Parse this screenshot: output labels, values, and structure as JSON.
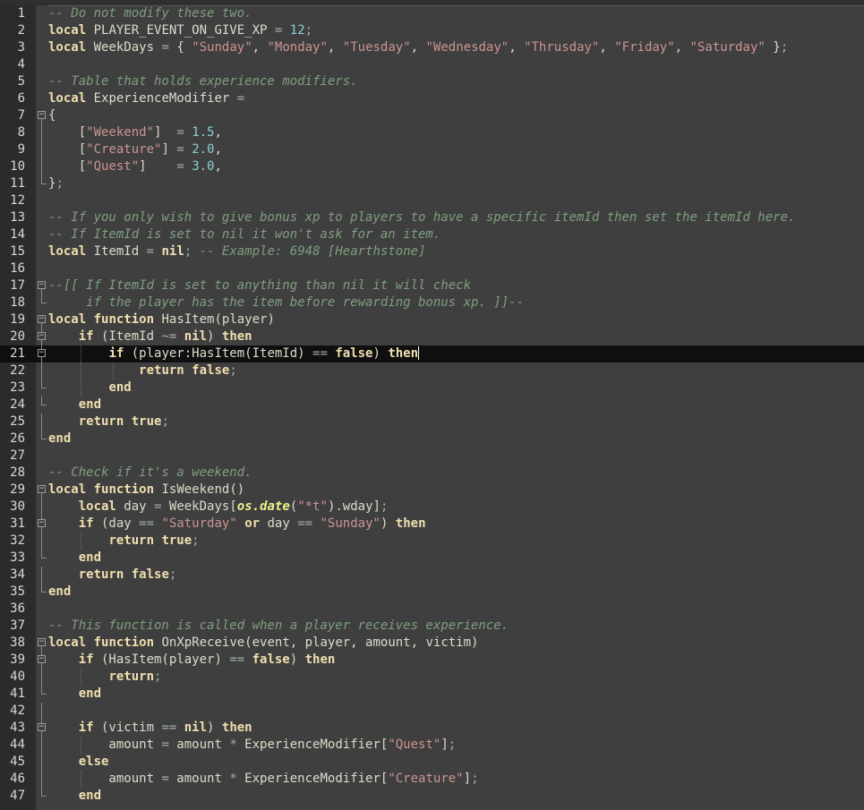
{
  "editor": {
    "language": "lua",
    "current_line": 21,
    "colors": {
      "background": "#3f3f3f",
      "comment": "#7f9f7f",
      "keyword": "#f0dfaf",
      "string": "#cc9393",
      "number": "#8cd0d3",
      "current_line": "#0f0f0f"
    },
    "lines": [
      {
        "n": "1",
        "indent": 0,
        "fold": "",
        "tokens": [
          {
            "t": "cm",
            "v": "-- Do not modify these two."
          }
        ]
      },
      {
        "n": "2",
        "indent": 0,
        "fold": "",
        "tokens": [
          {
            "t": "kw",
            "v": "local"
          },
          {
            "t": "tx",
            "v": " PLAYER_EVENT_ON_GIVE_XP "
          },
          {
            "t": "op",
            "v": "="
          },
          {
            "t": "tx",
            "v": " "
          },
          {
            "t": "num",
            "v": "12"
          },
          {
            "t": "op",
            "v": ";"
          }
        ]
      },
      {
        "n": "3",
        "indent": 0,
        "fold": "",
        "tokens": [
          {
            "t": "kw",
            "v": "local"
          },
          {
            "t": "tx",
            "v": " WeekDays "
          },
          {
            "t": "op",
            "v": "="
          },
          {
            "t": "tx",
            "v": " { "
          },
          {
            "t": "str",
            "v": "\"Sunday\""
          },
          {
            "t": "tx",
            "v": ", "
          },
          {
            "t": "str",
            "v": "\"Monday\""
          },
          {
            "t": "tx",
            "v": ", "
          },
          {
            "t": "str",
            "v": "\"Tuesday\""
          },
          {
            "t": "tx",
            "v": ", "
          },
          {
            "t": "str",
            "v": "\"Wednesday\""
          },
          {
            "t": "tx",
            "v": ", "
          },
          {
            "t": "str",
            "v": "\"Thrusday\""
          },
          {
            "t": "tx",
            "v": ", "
          },
          {
            "t": "str",
            "v": "\"Friday\""
          },
          {
            "t": "tx",
            "v": ", "
          },
          {
            "t": "str",
            "v": "\"Saturday\""
          },
          {
            "t": "tx",
            "v": " }"
          },
          {
            "t": "op",
            "v": ";"
          }
        ]
      },
      {
        "n": "4",
        "indent": 0,
        "fold": "",
        "tokens": []
      },
      {
        "n": "5",
        "indent": 0,
        "fold": "",
        "tokens": [
          {
            "t": "cm",
            "v": "-- Table that holds experience modifiers."
          }
        ]
      },
      {
        "n": "6",
        "indent": 0,
        "fold": "",
        "tokens": [
          {
            "t": "kw",
            "v": "local"
          },
          {
            "t": "tx",
            "v": " ExperienceModifier "
          },
          {
            "t": "op",
            "v": "="
          }
        ]
      },
      {
        "n": "7",
        "indent": 0,
        "fold": "open",
        "tokens": [
          {
            "t": "tx",
            "v": "{"
          }
        ]
      },
      {
        "n": "8",
        "indent": 1,
        "fold": "line",
        "tokens": [
          {
            "t": "tx",
            "v": "    ["
          },
          {
            "t": "str",
            "v": "\"Weekend\""
          },
          {
            "t": "tx",
            "v": "]  "
          },
          {
            "t": "op",
            "v": "="
          },
          {
            "t": "tx",
            "v": " "
          },
          {
            "t": "num",
            "v": "1.5"
          },
          {
            "t": "tx",
            "v": ","
          }
        ]
      },
      {
        "n": "9",
        "indent": 1,
        "fold": "line",
        "tokens": [
          {
            "t": "tx",
            "v": "    ["
          },
          {
            "t": "str",
            "v": "\"Creature\""
          },
          {
            "t": "tx",
            "v": "] "
          },
          {
            "t": "op",
            "v": "="
          },
          {
            "t": "tx",
            "v": " "
          },
          {
            "t": "num",
            "v": "2.0"
          },
          {
            "t": "tx",
            "v": ","
          }
        ]
      },
      {
        "n": "10",
        "indent": 1,
        "fold": "line",
        "tokens": [
          {
            "t": "tx",
            "v": "    ["
          },
          {
            "t": "str",
            "v": "\"Quest\""
          },
          {
            "t": "tx",
            "v": "]    "
          },
          {
            "t": "op",
            "v": "="
          },
          {
            "t": "tx",
            "v": " "
          },
          {
            "t": "num",
            "v": "3.0"
          },
          {
            "t": "tx",
            "v": ","
          }
        ]
      },
      {
        "n": "11",
        "indent": 0,
        "fold": "end",
        "tokens": [
          {
            "t": "tx",
            "v": "}"
          },
          {
            "t": "op",
            "v": ";"
          }
        ]
      },
      {
        "n": "12",
        "indent": 0,
        "fold": "",
        "tokens": []
      },
      {
        "n": "13",
        "indent": 0,
        "fold": "",
        "tokens": [
          {
            "t": "cm",
            "v": "-- If you only wish to give bonus xp to players to have a specific itemId then set the itemId here."
          }
        ]
      },
      {
        "n": "14",
        "indent": 0,
        "fold": "",
        "tokens": [
          {
            "t": "cm",
            "v": "-- If ItemId is set to nil it won't ask for an item."
          }
        ]
      },
      {
        "n": "15",
        "indent": 0,
        "fold": "",
        "tokens": [
          {
            "t": "kw",
            "v": "local"
          },
          {
            "t": "tx",
            "v": " ItemId "
          },
          {
            "t": "op",
            "v": "="
          },
          {
            "t": "tx",
            "v": " "
          },
          {
            "t": "kw",
            "v": "nil"
          },
          {
            "t": "op",
            "v": ";"
          },
          {
            "t": "tx",
            "v": " "
          },
          {
            "t": "cm",
            "v": "-- Example: 6948 [Hearthstone]"
          }
        ]
      },
      {
        "n": "16",
        "indent": 0,
        "fold": "",
        "tokens": []
      },
      {
        "n": "17",
        "indent": 0,
        "fold": "open",
        "tokens": [
          {
            "t": "cm",
            "v": "--[[ If ItemId is set to anything than nil it will check"
          }
        ]
      },
      {
        "n": "18",
        "indent": 0,
        "fold": "end",
        "tokens": [
          {
            "t": "cm",
            "v": "     if the player has the item before rewarding bonus xp. ]]--"
          }
        ]
      },
      {
        "n": "19",
        "indent": 0,
        "fold": "open",
        "tokens": [
          {
            "t": "kw",
            "v": "local"
          },
          {
            "t": "tx",
            "v": " "
          },
          {
            "t": "kw",
            "v": "function"
          },
          {
            "t": "tx",
            "v": " HasItem(player)"
          }
        ]
      },
      {
        "n": "20",
        "indent": 1,
        "fold": "open",
        "tokens": [
          {
            "t": "tx",
            "v": "    "
          },
          {
            "t": "kw",
            "v": "if"
          },
          {
            "t": "tx",
            "v": " (ItemId "
          },
          {
            "t": "op",
            "v": "~="
          },
          {
            "t": "tx",
            "v": " "
          },
          {
            "t": "kw",
            "v": "nil"
          },
          {
            "t": "tx",
            "v": ") "
          },
          {
            "t": "kw",
            "v": "then"
          }
        ]
      },
      {
        "n": "21",
        "indent": 2,
        "fold": "open",
        "tokens": [
          {
            "t": "tx",
            "v": "        "
          },
          {
            "t": "kw",
            "v": "if"
          },
          {
            "t": "tx",
            "v": " (player:HasItem(ItemId) "
          },
          {
            "t": "op",
            "v": "=="
          },
          {
            "t": "tx",
            "v": " "
          },
          {
            "t": "kw",
            "v": "false"
          },
          {
            "t": "tx",
            "v": ") "
          },
          {
            "t": "kw",
            "v": "then"
          },
          {
            "t": "caret",
            "v": ""
          }
        ]
      },
      {
        "n": "22",
        "indent": 3,
        "fold": "line",
        "tokens": [
          {
            "t": "tx",
            "v": "            "
          },
          {
            "t": "kw",
            "v": "return"
          },
          {
            "t": "tx",
            "v": " "
          },
          {
            "t": "kw",
            "v": "false"
          },
          {
            "t": "op",
            "v": ";"
          }
        ]
      },
      {
        "n": "23",
        "indent": 2,
        "fold": "end",
        "tokens": [
          {
            "t": "tx",
            "v": "        "
          },
          {
            "t": "kw",
            "v": "end"
          }
        ]
      },
      {
        "n": "24",
        "indent": 1,
        "fold": "end",
        "tokens": [
          {
            "t": "tx",
            "v": "    "
          },
          {
            "t": "kw",
            "v": "end"
          }
        ]
      },
      {
        "n": "25",
        "indent": 1,
        "fold": "line",
        "tokens": [
          {
            "t": "tx",
            "v": "    "
          },
          {
            "t": "kw",
            "v": "return"
          },
          {
            "t": "tx",
            "v": " "
          },
          {
            "t": "kw",
            "v": "true"
          },
          {
            "t": "op",
            "v": ";"
          }
        ]
      },
      {
        "n": "26",
        "indent": 0,
        "fold": "end",
        "tokens": [
          {
            "t": "kw",
            "v": "end"
          }
        ]
      },
      {
        "n": "27",
        "indent": 0,
        "fold": "",
        "tokens": []
      },
      {
        "n": "28",
        "indent": 0,
        "fold": "",
        "tokens": [
          {
            "t": "cm",
            "v": "-- Check if it's a weekend."
          }
        ]
      },
      {
        "n": "29",
        "indent": 0,
        "fold": "open",
        "tokens": [
          {
            "t": "kw",
            "v": "local"
          },
          {
            "t": "tx",
            "v": " "
          },
          {
            "t": "kw",
            "v": "function"
          },
          {
            "t": "tx",
            "v": " IsWeekend()"
          }
        ]
      },
      {
        "n": "30",
        "indent": 1,
        "fold": "line",
        "tokens": [
          {
            "t": "tx",
            "v": "    "
          },
          {
            "t": "kw",
            "v": "local"
          },
          {
            "t": "tx",
            "v": " day "
          },
          {
            "t": "op",
            "v": "="
          },
          {
            "t": "tx",
            "v": " WeekDays["
          },
          {
            "t": "lib",
            "v": "os.date"
          },
          {
            "t": "tx",
            "v": "("
          },
          {
            "t": "str",
            "v": "\"*t\""
          },
          {
            "t": "tx",
            "v": ").wday]"
          },
          {
            "t": "op",
            "v": ";"
          }
        ]
      },
      {
        "n": "31",
        "indent": 1,
        "fold": "open",
        "tokens": [
          {
            "t": "tx",
            "v": "    "
          },
          {
            "t": "kw",
            "v": "if"
          },
          {
            "t": "tx",
            "v": " (day "
          },
          {
            "t": "op",
            "v": "=="
          },
          {
            "t": "tx",
            "v": " "
          },
          {
            "t": "str",
            "v": "\"Saturday\""
          },
          {
            "t": "tx",
            "v": " "
          },
          {
            "t": "kw",
            "v": "or"
          },
          {
            "t": "tx",
            "v": " day "
          },
          {
            "t": "op",
            "v": "=="
          },
          {
            "t": "tx",
            "v": " "
          },
          {
            "t": "str",
            "v": "\"Sunday\""
          },
          {
            "t": "tx",
            "v": ") "
          },
          {
            "t": "kw",
            "v": "then"
          }
        ]
      },
      {
        "n": "32",
        "indent": 2,
        "fold": "line",
        "tokens": [
          {
            "t": "tx",
            "v": "        "
          },
          {
            "t": "kw",
            "v": "return"
          },
          {
            "t": "tx",
            "v": " "
          },
          {
            "t": "kw",
            "v": "true"
          },
          {
            "t": "op",
            "v": ";"
          }
        ]
      },
      {
        "n": "33",
        "indent": 1,
        "fold": "end",
        "tokens": [
          {
            "t": "tx",
            "v": "    "
          },
          {
            "t": "kw",
            "v": "end"
          }
        ]
      },
      {
        "n": "34",
        "indent": 1,
        "fold": "line",
        "tokens": [
          {
            "t": "tx",
            "v": "    "
          },
          {
            "t": "kw",
            "v": "return"
          },
          {
            "t": "tx",
            "v": " "
          },
          {
            "t": "kw",
            "v": "false"
          },
          {
            "t": "op",
            "v": ";"
          }
        ]
      },
      {
        "n": "35",
        "indent": 0,
        "fold": "end",
        "tokens": [
          {
            "t": "kw",
            "v": "end"
          }
        ]
      },
      {
        "n": "36",
        "indent": 0,
        "fold": "",
        "tokens": []
      },
      {
        "n": "37",
        "indent": 0,
        "fold": "",
        "tokens": [
          {
            "t": "cm",
            "v": "-- This function is called when a player receives experience."
          }
        ]
      },
      {
        "n": "38",
        "indent": 0,
        "fold": "open",
        "tokens": [
          {
            "t": "kw",
            "v": "local"
          },
          {
            "t": "tx",
            "v": " "
          },
          {
            "t": "kw",
            "v": "function"
          },
          {
            "t": "tx",
            "v": " OnXpReceive(event, player, amount, victim)"
          }
        ]
      },
      {
        "n": "39",
        "indent": 1,
        "fold": "open",
        "tokens": [
          {
            "t": "tx",
            "v": "    "
          },
          {
            "t": "kw",
            "v": "if"
          },
          {
            "t": "tx",
            "v": " (HasItem(player) "
          },
          {
            "t": "op",
            "v": "=="
          },
          {
            "t": "tx",
            "v": " "
          },
          {
            "t": "kw",
            "v": "false"
          },
          {
            "t": "tx",
            "v": ") "
          },
          {
            "t": "kw",
            "v": "then"
          }
        ]
      },
      {
        "n": "40",
        "indent": 2,
        "fold": "line",
        "tokens": [
          {
            "t": "tx",
            "v": "        "
          },
          {
            "t": "kw",
            "v": "return"
          },
          {
            "t": "op",
            "v": ";"
          }
        ]
      },
      {
        "n": "41",
        "indent": 1,
        "fold": "end",
        "tokens": [
          {
            "t": "tx",
            "v": "    "
          },
          {
            "t": "kw",
            "v": "end"
          }
        ]
      },
      {
        "n": "42",
        "indent": 1,
        "fold": "line",
        "tokens": []
      },
      {
        "n": "43",
        "indent": 1,
        "fold": "open",
        "tokens": [
          {
            "t": "tx",
            "v": "    "
          },
          {
            "t": "kw",
            "v": "if"
          },
          {
            "t": "tx",
            "v": " (victim "
          },
          {
            "t": "op",
            "v": "=="
          },
          {
            "t": "tx",
            "v": " "
          },
          {
            "t": "kw",
            "v": "nil"
          },
          {
            "t": "tx",
            "v": ") "
          },
          {
            "t": "kw",
            "v": "then"
          }
        ]
      },
      {
        "n": "44",
        "indent": 2,
        "fold": "line",
        "tokens": [
          {
            "t": "tx",
            "v": "        amount "
          },
          {
            "t": "op",
            "v": "="
          },
          {
            "t": "tx",
            "v": " amount "
          },
          {
            "t": "op",
            "v": "*"
          },
          {
            "t": "tx",
            "v": " ExperienceModifier["
          },
          {
            "t": "str",
            "v": "\"Quest\""
          },
          {
            "t": "tx",
            "v": "]"
          },
          {
            "t": "op",
            "v": ";"
          }
        ]
      },
      {
        "n": "45",
        "indent": 1,
        "fold": "line",
        "tokens": [
          {
            "t": "tx",
            "v": "    "
          },
          {
            "t": "kw",
            "v": "else"
          }
        ]
      },
      {
        "n": "46",
        "indent": 2,
        "fold": "line",
        "tokens": [
          {
            "t": "tx",
            "v": "        amount "
          },
          {
            "t": "op",
            "v": "="
          },
          {
            "t": "tx",
            "v": " amount "
          },
          {
            "t": "op",
            "v": "*"
          },
          {
            "t": "tx",
            "v": " ExperienceModifier["
          },
          {
            "t": "str",
            "v": "\"Creature\""
          },
          {
            "t": "tx",
            "v": "]"
          },
          {
            "t": "op",
            "v": ";"
          }
        ]
      },
      {
        "n": "47",
        "indent": 1,
        "fold": "end",
        "tokens": [
          {
            "t": "tx",
            "v": "    "
          },
          {
            "t": "kw",
            "v": "end"
          }
        ]
      }
    ]
  }
}
